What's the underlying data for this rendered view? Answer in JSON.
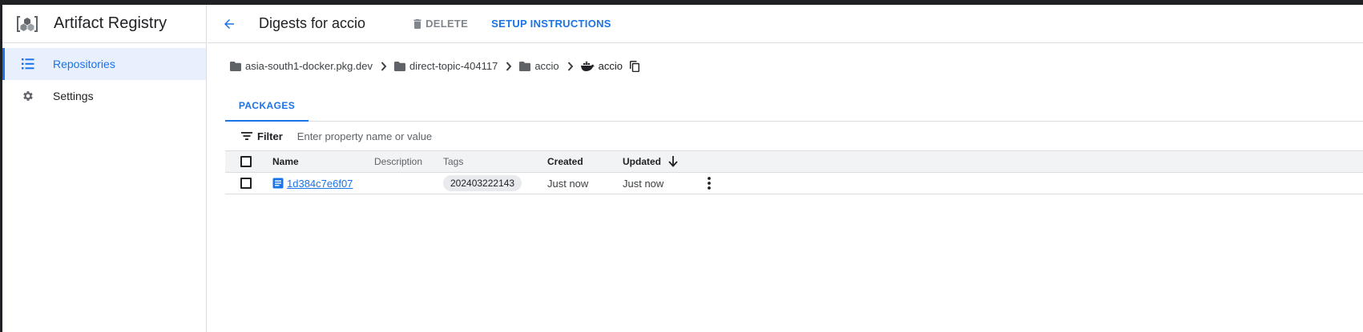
{
  "app": {
    "title": "Artifact Registry",
    "logo_icon": "artifact-registry-logo"
  },
  "sidebar": {
    "items": [
      {
        "label": "Repositories",
        "icon": "list-icon",
        "active": true
      },
      {
        "label": "Settings",
        "icon": "gear-icon",
        "active": false
      }
    ]
  },
  "header": {
    "title": "Digests for accio",
    "delete_label": "DELETE",
    "setup_label": "SETUP INSTRUCTIONS"
  },
  "breadcrumb": {
    "items": [
      {
        "label": "asia-south1-docker.pkg.dev",
        "icon": "folder-icon"
      },
      {
        "label": "direct-topic-404117",
        "icon": "folder-icon"
      },
      {
        "label": "accio",
        "icon": "folder-icon"
      },
      {
        "label": "accio",
        "icon": "docker-icon"
      }
    ],
    "copy_icon": "copy-icon"
  },
  "tabs": [
    {
      "label": "PACKAGES",
      "active": true
    }
  ],
  "filter": {
    "label": "Filter",
    "placeholder": "Enter property name or value"
  },
  "table": {
    "columns": {
      "name": "Name",
      "description": "Description",
      "tags": "Tags",
      "created": "Created",
      "updated": "Updated"
    },
    "sort": {
      "column": "updated",
      "direction": "descending"
    },
    "rows": [
      {
        "name": "1d384c7e6f07",
        "description": "",
        "tag": "202403222143",
        "created": "Just now",
        "updated": "Just now"
      }
    ]
  },
  "colors": {
    "accent": "#1a73e8",
    "active_bg": "#e8f0fe",
    "header_bg": "#f1f3f4",
    "border": "#dadce0"
  }
}
